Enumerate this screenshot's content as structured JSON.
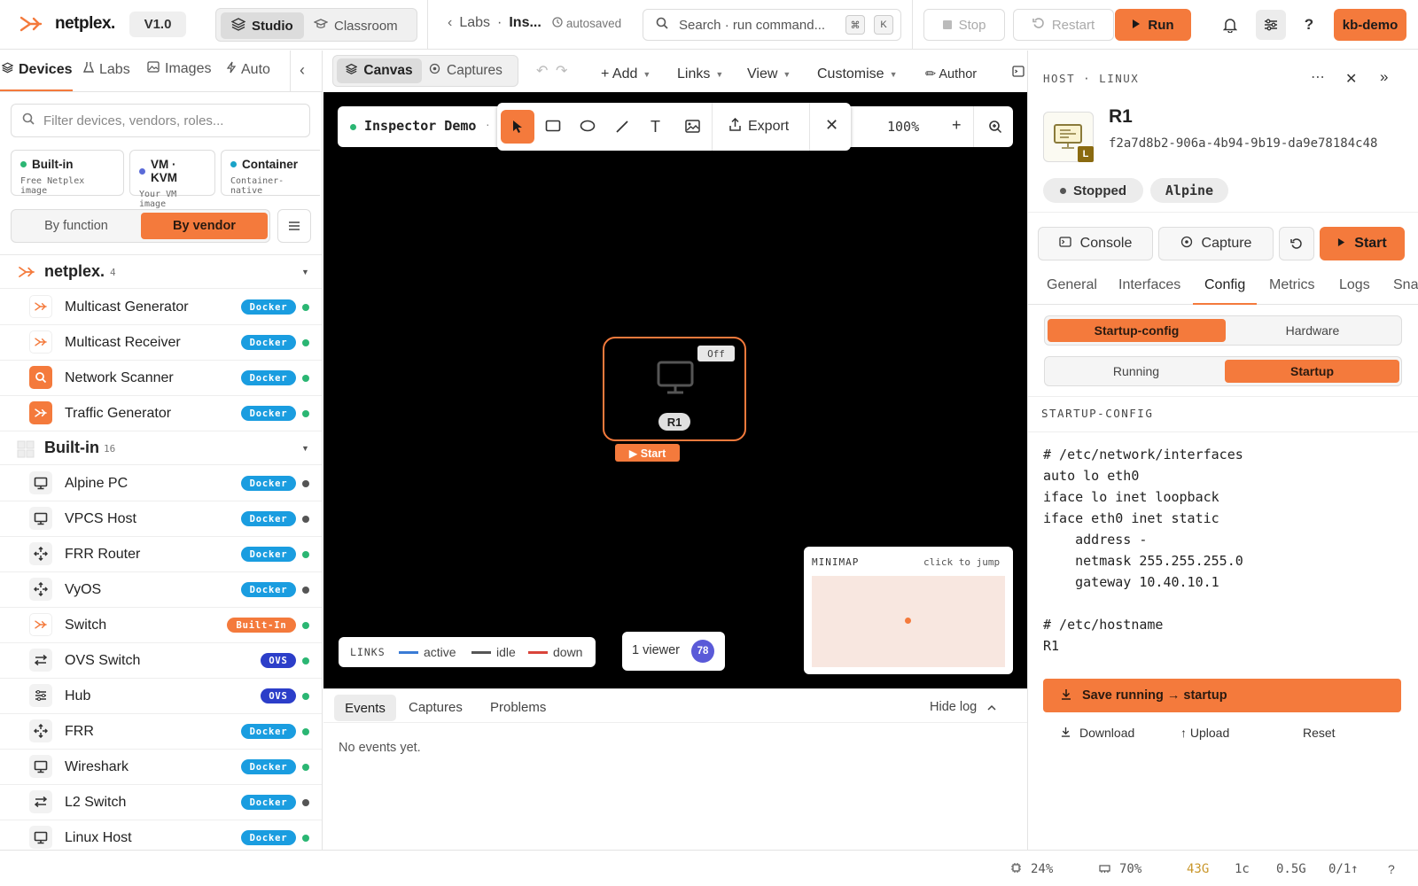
{
  "app": {
    "name": "netplex.",
    "version": "V1.0"
  },
  "topbar": {
    "modes": [
      {
        "label": "Studio"
      },
      {
        "label": "Classroom"
      }
    ],
    "breadcrumb": {
      "parent": "Labs",
      "current": "Ins...",
      "status": "autosaved"
    },
    "search": {
      "placeholder": "Search · run command...",
      "key1": "⌘",
      "key2": "K"
    },
    "stop_label": "Stop",
    "restart_label": "Restart",
    "run_label": "Run",
    "user": "kb-demo"
  },
  "sidebar": {
    "tabs": [
      {
        "label": "Devices"
      },
      {
        "label": "Labs"
      },
      {
        "label": "Images"
      },
      {
        "label": "Auto"
      }
    ],
    "filter_placeholder": "Filter devices, vendors, roles...",
    "cards": [
      {
        "title": "Built-in",
        "sub": "Free Netplex image",
        "color": "#2bb673"
      },
      {
        "title": "VM · KVM",
        "sub": "Your VM image",
        "color": "#5b6bd8"
      },
      {
        "title": "Container",
        "sub": "Container-native",
        "color": "#1aa3c8"
      }
    ],
    "group_toggle": {
      "by_function": "By function",
      "by_vendor": "By vendor"
    },
    "groups": [
      {
        "name": "netplex.",
        "count": "4",
        "devices": [
          {
            "name": "Multicast Generator",
            "badge": "Docker",
            "status": "green",
            "icon": "netplex-icon"
          },
          {
            "name": "Multicast Receiver",
            "badge": "Docker",
            "status": "green",
            "icon": "netplex-icon"
          },
          {
            "name": "Network Scanner",
            "badge": "Docker",
            "status": "green",
            "icon": "scanner-icon"
          },
          {
            "name": "Traffic Generator",
            "badge": "Docker",
            "status": "green",
            "icon": "traffic-icon"
          }
        ]
      },
      {
        "name": "Built-in",
        "count": "16",
        "devices": [
          {
            "name": "Alpine PC",
            "badge": "Docker",
            "status": "grey",
            "icon": "monitor-icon"
          },
          {
            "name": "VPCS Host",
            "badge": "Docker",
            "status": "grey",
            "icon": "monitor-icon"
          },
          {
            "name": "FRR Router",
            "badge": "Docker",
            "status": "green",
            "icon": "router-icon"
          },
          {
            "name": "VyOS",
            "badge": "Docker",
            "status": "grey",
            "icon": "router-icon"
          },
          {
            "name": "Switch",
            "badge": "Built-In",
            "status": "green",
            "icon": "netplex-icon"
          },
          {
            "name": "OVS Switch",
            "badge": "OVS",
            "status": "green",
            "icon": "switch-icon"
          },
          {
            "name": "Hub",
            "badge": "OVS",
            "status": "green",
            "icon": "hub-icon"
          },
          {
            "name": "FRR",
            "badge": "Docker",
            "status": "green",
            "icon": "router-icon"
          },
          {
            "name": "Wireshark",
            "badge": "Docker",
            "status": "green",
            "icon": "monitor-icon"
          },
          {
            "name": "L2 Switch",
            "badge": "Docker",
            "status": "grey",
            "icon": "switch-icon"
          },
          {
            "name": "Linux Host",
            "badge": "Docker",
            "status": "green",
            "icon": "monitor-icon"
          }
        ]
      }
    ]
  },
  "canvas_toolbar": {
    "tabs": [
      {
        "label": "Canvas"
      },
      {
        "label": "Captures"
      }
    ],
    "menus": [
      {
        "label": "+ Add"
      },
      {
        "label": "Links"
      },
      {
        "label": "View"
      },
      {
        "label": "Customise"
      }
    ],
    "author": "✏ Author"
  },
  "canvas": {
    "lab_name": "Inspector Demo",
    "export_label": "Export",
    "zoom": "100%",
    "node": {
      "name": "R1",
      "state": "Off",
      "start_label": "▶ Start"
    },
    "legend": {
      "title": "LINKS",
      "items": [
        {
          "label": "active",
          "color": "#3a7bd5"
        },
        {
          "label": "idle",
          "color": "#555555"
        },
        {
          "label": "down",
          "color": "#d9443a"
        }
      ]
    },
    "viewers": {
      "label": "1 viewer",
      "avatar": "78"
    },
    "minimap": {
      "title": "MINIMAP",
      "hint": "click to jump"
    }
  },
  "log": {
    "tabs": [
      {
        "label": "Events"
      },
      {
        "label": "Captures"
      },
      {
        "label": "Problems"
      }
    ],
    "hide_label": "Hide log",
    "empty": "No events yet."
  },
  "inspector": {
    "kind": "HOST · LINUX",
    "name": "R1",
    "uuid": "f2a7d8b2-906a-4b94-9b19-da9e78184c48",
    "icon_badge": "L",
    "status": "Stopped",
    "image": "Alpine",
    "actions": {
      "console": "Console",
      "capture": "Capture",
      "start": "Start"
    },
    "tabs": [
      {
        "label": "General"
      },
      {
        "label": "Interfaces"
      },
      {
        "label": "Config"
      },
      {
        "label": "Metrics"
      },
      {
        "label": "Logs"
      },
      {
        "label": "Snap"
      }
    ],
    "config_switch": {
      "a": "Startup-config",
      "b": "Hardware"
    },
    "mode_switch": {
      "a": "Running",
      "b": "Startup"
    },
    "section_title": "STARTUP-CONFIG",
    "config_text": "# /etc/network/interfaces\nauto lo eth0\niface lo inet loopback\niface eth0 inet static\n    address -\n    netmask 255.255.255.0\n    gateway 10.40.10.1\n\n# /etc/hostname\nR1",
    "save_label": "Save running → startup",
    "download": "Download",
    "upload": "↑ Upload",
    "reset": "Reset"
  },
  "statusbar": {
    "cpu": "24%",
    "mem": "70%",
    "disk": "43G",
    "cores": "1c",
    "load": "0.5G",
    "net": "0/1↑",
    "help": "?"
  },
  "colors": {
    "accent": "#f47a3c",
    "docker": "#1a9de0",
    "ovs": "#2c3ec9",
    "builtin": "#f47a3c",
    "green": "#2bb673",
    "grey": "#555555"
  }
}
